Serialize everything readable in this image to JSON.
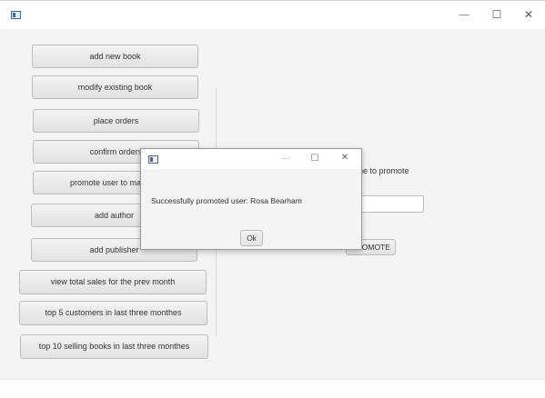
{
  "window": {
    "controls": {
      "minimize": "—",
      "maximize": "☐",
      "close": "✕"
    }
  },
  "menu_buttons": [
    {
      "label": "add new book"
    },
    {
      "label": "modify existing book"
    },
    {
      "label": "place orders"
    },
    {
      "label": "confirm orders"
    },
    {
      "label": "promote user to manager"
    },
    {
      "label": "add author"
    },
    {
      "label": "add publisher"
    },
    {
      "label": "view total sales for the prev month"
    },
    {
      "label": "top 5 customers in last three monthes"
    },
    {
      "label": "top 10 selling books in last three monthes"
    }
  ],
  "promote_panel": {
    "prompt_label": "Enter username to promote",
    "username_value": "",
    "promote_button": "PROMOTE"
  },
  "dialog": {
    "controls": {
      "minimize": "—",
      "maximize": "☐",
      "close": "✕"
    },
    "message": "Successfully promoted user: Rosa Bearham",
    "ok_label": "Ok"
  }
}
